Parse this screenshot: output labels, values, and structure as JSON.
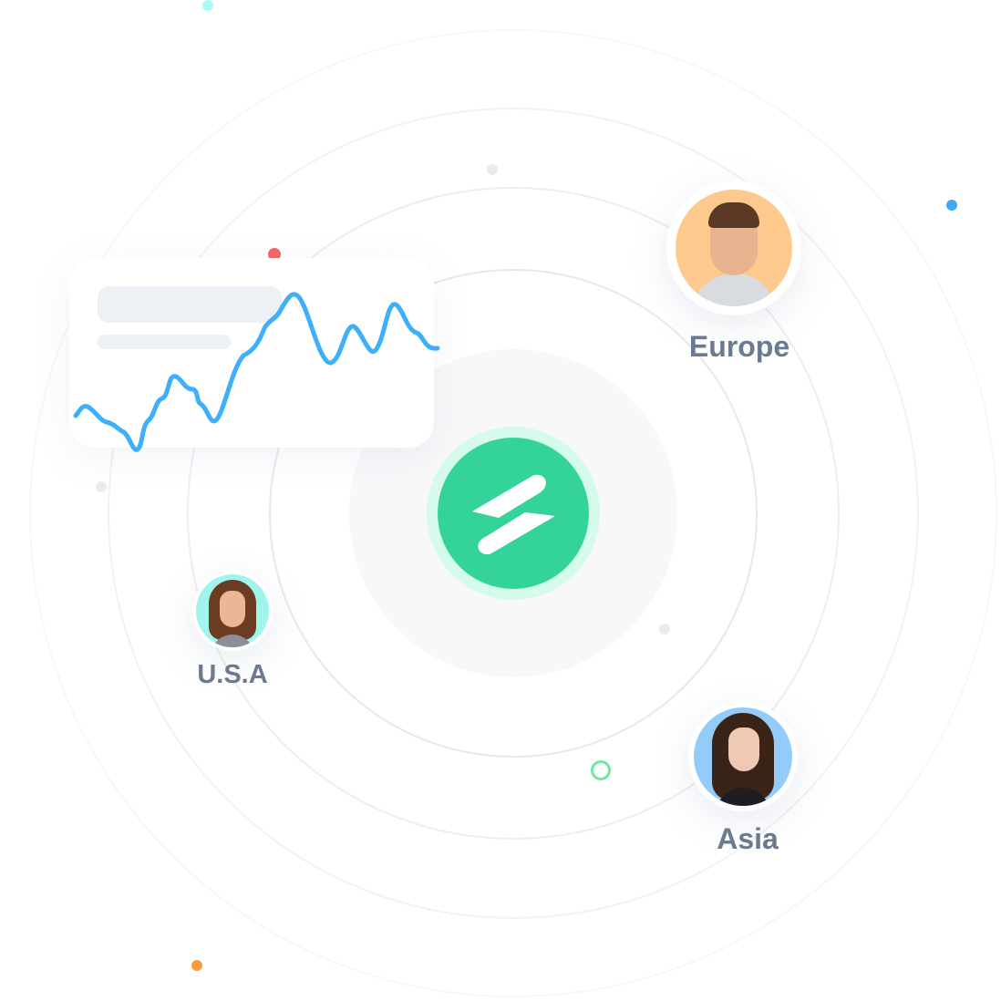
{
  "logo": {
    "icon": "bolt-logo-icon",
    "color": "#34d399",
    "halo": "#d4fbec"
  },
  "regions": [
    {
      "label": "Europe",
      "bg": "#fec98d"
    },
    {
      "label": "U.S.A",
      "bg": "#9ff5ec"
    },
    {
      "label": "Asia",
      "bg": "#93cbfb"
    }
  ],
  "chart_card": {
    "line_color": "#3eb0fb"
  }
}
